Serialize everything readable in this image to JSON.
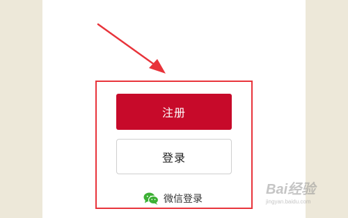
{
  "buttons": {
    "register_label": "注册",
    "login_label": "登录"
  },
  "wechat": {
    "label": "微信登录",
    "icon": "wechat-icon"
  },
  "watermark": {
    "brand": "Bai经验",
    "url": "jingyan.baidu.com"
  },
  "colors": {
    "register_bg": "#c70a2a",
    "highlight": "#e8333a",
    "wechat_green": "#3cb034",
    "side_background": "#ede8d9"
  }
}
